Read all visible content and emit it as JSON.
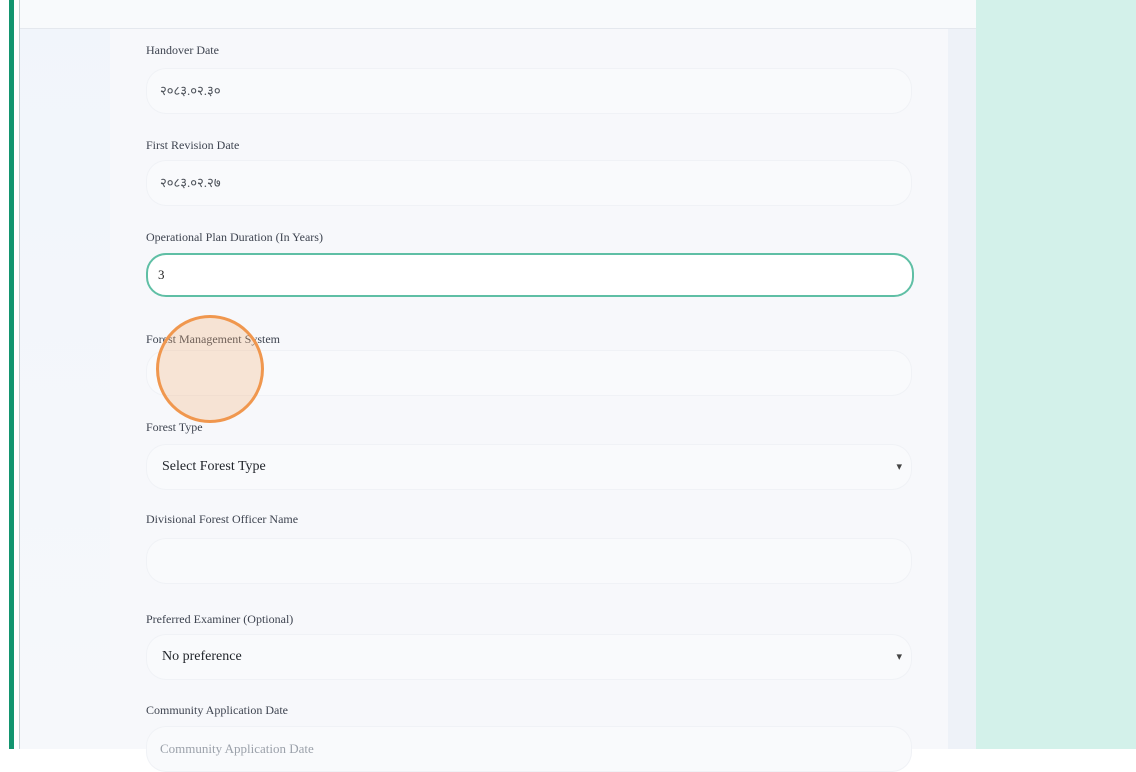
{
  "form": {
    "handover_date": {
      "label": "Handover Date",
      "value": "२०८३.०२.३० "
    },
    "first_revision_date": {
      "label": "First Revision Date",
      "value": "२०८३.०२.२७"
    },
    "operational_plan_duration": {
      "label": "Operational Plan Duration (In Years)",
      "value": "3"
    },
    "forest_management_system": {
      "label": "Forest Management System",
      "value": ""
    },
    "forest_type": {
      "label": "Forest Type",
      "selected": "Select Forest Type"
    },
    "divisional_forest_officer_name": {
      "label": "Divisional Forest Officer Name",
      "value": ""
    },
    "preferred_examiner": {
      "label": "Preferred Examiner (Optional)",
      "selected": "No preference"
    },
    "community_application_date": {
      "label": "Community Application Date",
      "placeholder": "Community Application Date"
    }
  },
  "icons": {
    "select_chevron": "chevron-down-icon"
  },
  "colors": {
    "accent": "#13956f",
    "focus_border": "#5fbfa5",
    "right_panel": "#d3f1ea",
    "cursor_ring": "#f0974e"
  }
}
